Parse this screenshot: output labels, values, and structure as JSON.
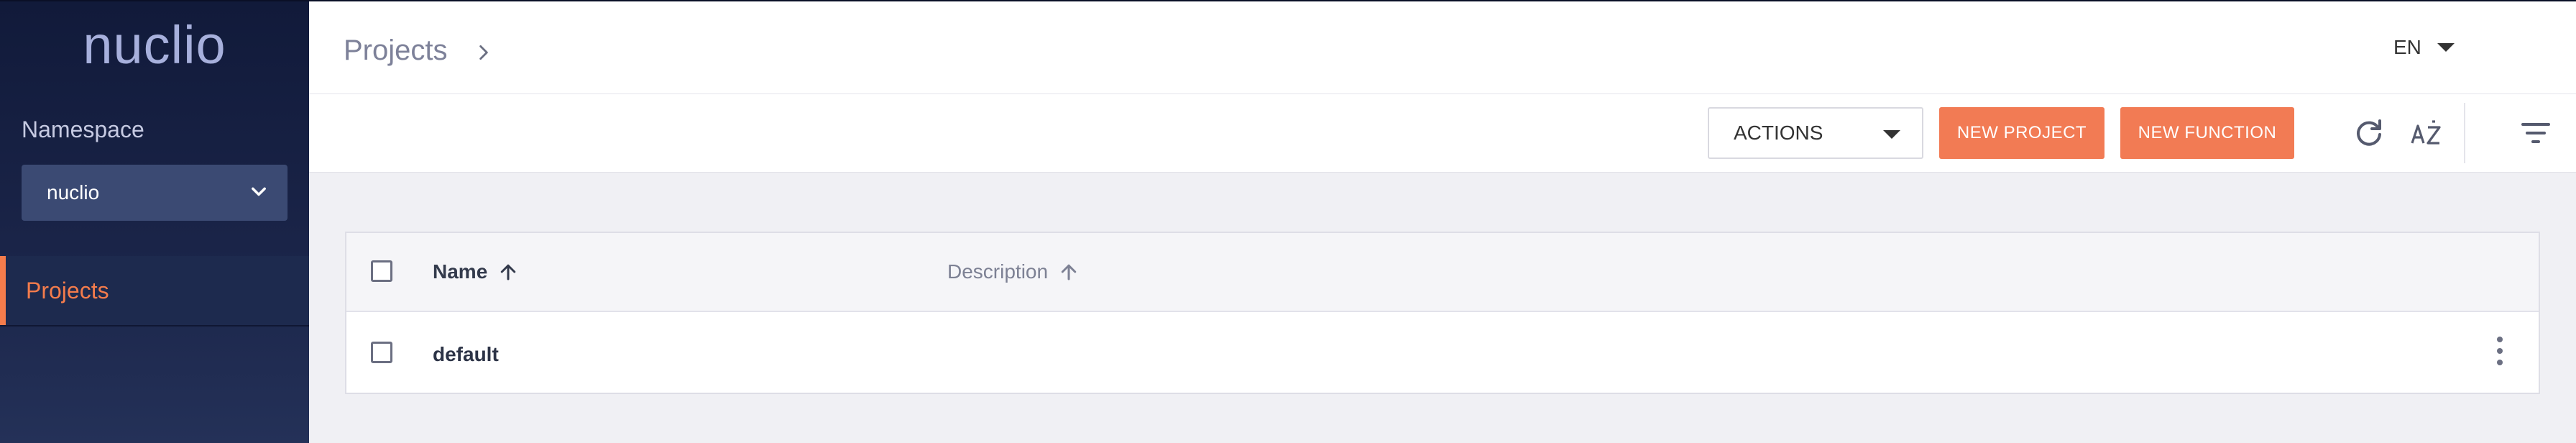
{
  "sidebar": {
    "logo": "nuclio",
    "namespace_label": "Namespace",
    "namespace_value": "nuclio",
    "nav_items": [
      {
        "label": "Projects",
        "active": true
      }
    ]
  },
  "header": {
    "breadcrumb": "Projects",
    "language": "EN"
  },
  "toolbar": {
    "actions_label": "ACTIONS",
    "new_project_label": "NEW PROJECT",
    "new_function_label": "NEW FUNCTION",
    "icons": [
      "refresh-icon",
      "sort-az-icon",
      "filter-icon"
    ]
  },
  "table": {
    "columns": [
      {
        "label": "Name",
        "sort": "ascending"
      },
      {
        "label": "Description",
        "sort": "ascending"
      }
    ],
    "rows": [
      {
        "name": "default",
        "description": ""
      }
    ]
  },
  "colors": {
    "accent": "#f27b54",
    "sidebar_bg": "#1a2448",
    "namespace_select_bg": "#3b4a73"
  }
}
